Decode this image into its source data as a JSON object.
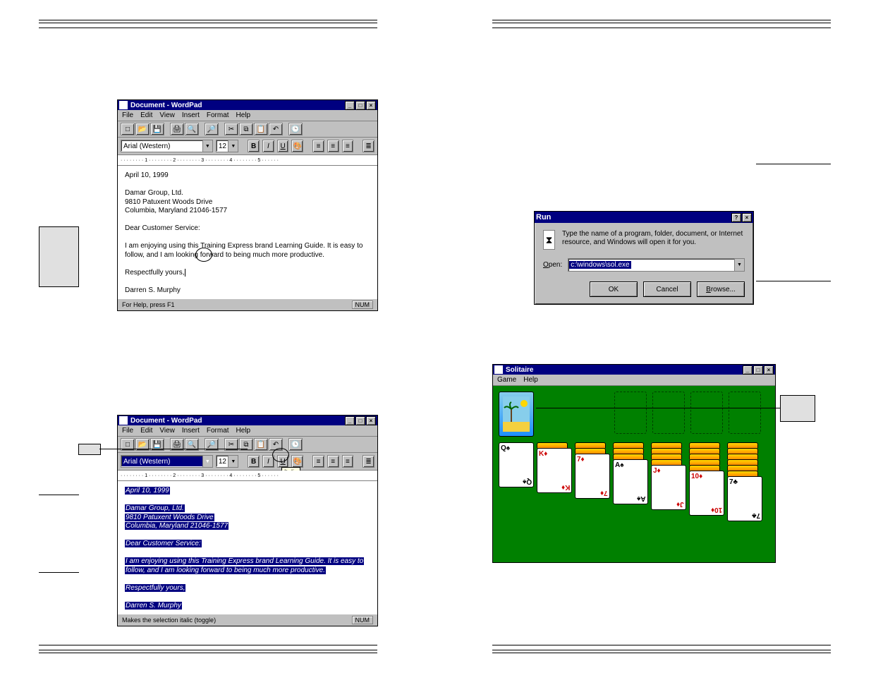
{
  "wordpad1": {
    "title": "Document - WordPad",
    "menus": [
      "File",
      "Edit",
      "View",
      "Insert",
      "Format",
      "Help"
    ],
    "font": "Arial (Western)",
    "size": "12",
    "doc": {
      "date": "April 10, 1999",
      "addr1": "Damar Group, Ltd.",
      "addr2": "9810 Patuxent Woods Drive",
      "addr3": "Columbia, Maryland  21046-1577",
      "greet": "Dear Customer Service:",
      "body1": "I am enjoying using this Training Express brand Learning Guide.  It is easy to",
      "body2": "follow, and I am looking forward to being much more productive.",
      "close": "Respectfully yours,",
      "sig": "Darren S. Murphy"
    },
    "status_left": "For Help, press F1",
    "status_right": "NUM"
  },
  "wordpad2": {
    "title": "Document - WordPad",
    "status_left": "Makes the selection italic (toggle)",
    "status_right": "NUM",
    "tooltip": "Italic"
  },
  "run": {
    "title": "Run",
    "help": "?",
    "instr": "Type the name of a program, folder, document, or Internet resource, and Windows will open it for you.",
    "open_label": "Open:",
    "open_value": "c:\\windows\\sol.exe",
    "ok": "OK",
    "cancel": "Cancel",
    "browse": "Browse..."
  },
  "solitaire": {
    "title": "Solitaire",
    "menus": [
      "Game",
      "Help"
    ],
    "cards": [
      {
        "rank": "Q",
        "suit": "♠",
        "color": "blk"
      },
      {
        "rank": "K",
        "suit": "♦",
        "color": "red"
      },
      {
        "rank": "7",
        "suit": "♦",
        "color": "red"
      },
      {
        "rank": "A",
        "suit": "♠",
        "color": "blk"
      },
      {
        "rank": "J",
        "suit": "♦",
        "color": "red"
      },
      {
        "rank": "10",
        "suit": "♦",
        "color": "red"
      },
      {
        "rank": "7",
        "suit": "♣",
        "color": "blk"
      }
    ]
  },
  "ruler_text": "· · · · · · · · 1 · · · · · · · · 2 · · · · · · · · 3 · · · · · · · · 4 · · · · · · · · 5 · · · · · ·"
}
